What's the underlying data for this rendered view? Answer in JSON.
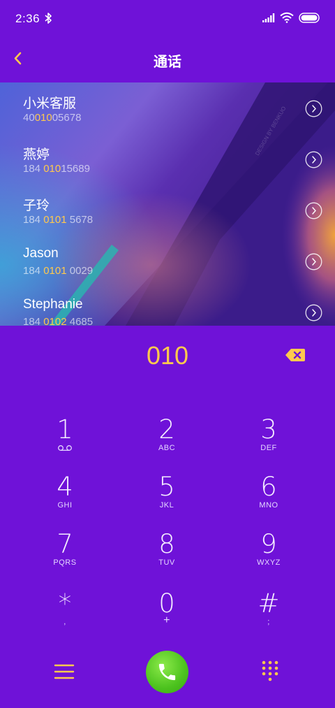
{
  "status_bar": {
    "time": "2:36"
  },
  "nav": {
    "title": "通话"
  },
  "banner": {
    "watermark": "DESIGN BY BENKUO"
  },
  "contacts": [
    {
      "name": "小米客服",
      "number_pre": "40",
      "number_hl": "010",
      "number_post": "05678"
    },
    {
      "name": "燕婷",
      "number_pre": "184 ",
      "number_hl": "010",
      "number_post": "15689"
    },
    {
      "name": "子玲",
      "number_pre": "184 ",
      "number_hl": "0101",
      "number_post": " 5678"
    },
    {
      "name": "Jason",
      "number_pre": "184 ",
      "number_hl": "0101",
      "number_post": " 0029"
    },
    {
      "name": "Stephanie",
      "number_pre": "184 ",
      "number_hl": "0102",
      "number_post": " 4685"
    }
  ],
  "dialer": {
    "input": "010"
  },
  "keypad": [
    {
      "digit": "1",
      "letters": ""
    },
    {
      "digit": "2",
      "letters": "ABC"
    },
    {
      "digit": "3",
      "letters": "DEF"
    },
    {
      "digit": "4",
      "letters": "GHI"
    },
    {
      "digit": "5",
      "letters": "JKL"
    },
    {
      "digit": "6",
      "letters": "MNO"
    },
    {
      "digit": "7",
      "letters": "PQRS"
    },
    {
      "digit": "8",
      "letters": "TUV"
    },
    {
      "digit": "9",
      "letters": "WXYZ"
    },
    {
      "digit": "*",
      "letters": ","
    },
    {
      "digit": "0",
      "letters": "+"
    },
    {
      "digit": "#",
      "letters": ";"
    }
  ],
  "colors": {
    "background": "#6f12d8",
    "accent": "#ffc94d",
    "call_green": "#4cc21e"
  },
  "icons": {
    "back": "chevron-left-icon",
    "bluetooth": "bluetooth-icon",
    "signal": "signal-icon",
    "wifi": "wifi-icon",
    "battery": "battery-icon",
    "detail": "chevron-circle-right-icon",
    "delete": "backspace-icon",
    "voicemail": "voicemail-icon",
    "menu": "menu-icon",
    "call": "phone-icon",
    "keypad": "dialpad-icon"
  }
}
